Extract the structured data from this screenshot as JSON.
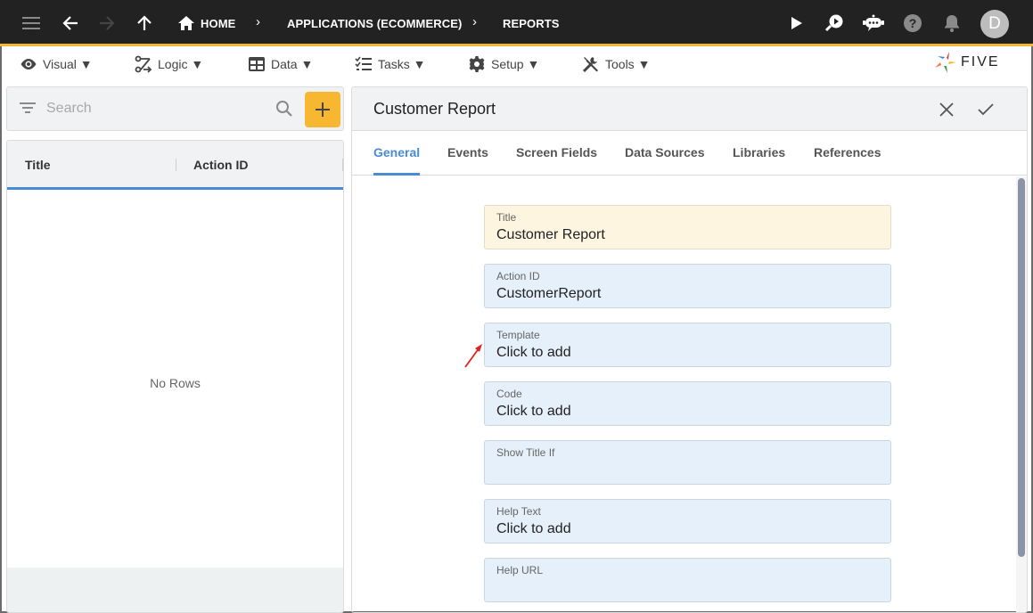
{
  "topbar": {
    "icons": [
      "menu-icon",
      "back-arrow-icon",
      "forward-arrow-icon",
      "up-arrow-icon"
    ],
    "breadcrumb": [
      {
        "label": "HOME",
        "icon": "home-icon"
      },
      {
        "label": "APPLICATIONS (ECOMMERCE)"
      },
      {
        "label": "REPORTS"
      }
    ],
    "right_icons": [
      "play-icon",
      "search-play-icon",
      "chat-bot-icon",
      "help-icon",
      "bell-icon"
    ],
    "avatar_initial": "D",
    "accent_color": "#f7b731"
  },
  "menubar": {
    "items": [
      {
        "label": "Visual ▼",
        "icon": "eye-icon"
      },
      {
        "label": "Logic ▼",
        "icon": "logic-flow-icon"
      },
      {
        "label": "Data ▼",
        "icon": "table-icon"
      },
      {
        "label": "Tasks ▼",
        "icon": "checklist-icon"
      },
      {
        "label": "Setup ▼",
        "icon": "gear-icon"
      },
      {
        "label": "Tools ▼",
        "icon": "tools-icon"
      }
    ],
    "logo_text": "FIVE"
  },
  "list_panel": {
    "search_placeholder": "Search",
    "add_label": "+",
    "columns": [
      "Title",
      "Action ID"
    ],
    "empty_text": "No Rows"
  },
  "form": {
    "title": "Customer Report",
    "tabs": [
      "General",
      "Events",
      "Screen Fields",
      "Data Sources",
      "Libraries",
      "References"
    ],
    "active_tab": "General",
    "fields": [
      {
        "label": "Title",
        "value": "Customer Report"
      },
      {
        "label": "Action ID",
        "value": "CustomerReport"
      },
      {
        "label": "Template",
        "value": "Click to add"
      },
      {
        "label": "Code",
        "value": "Click to add"
      },
      {
        "label": "Show Title If",
        "value": ""
      },
      {
        "label": "Help Text",
        "value": "Click to add"
      },
      {
        "label": "Help URL",
        "value": ""
      }
    ]
  }
}
